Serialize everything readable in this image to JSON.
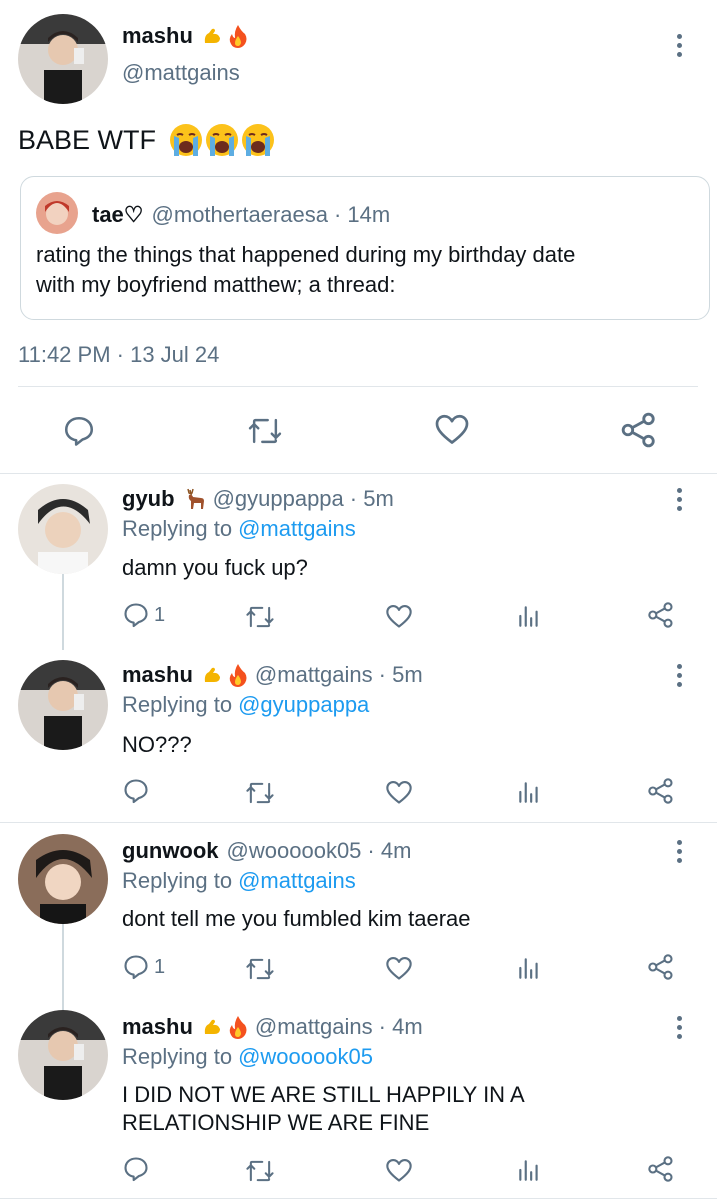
{
  "main_tweet": {
    "display_name": "mashu",
    "handle": "@mattgains",
    "text": "BABE WTF",
    "emojis": [
      "loudly-crying-face",
      "loudly-crying-face",
      "loudly-crying-face"
    ],
    "timestamp": "11:42 PM · 13 Jul 24",
    "quote": {
      "display_name": "tae♡",
      "handle": "@mothertaeraesa",
      "time": "· 14m",
      "line1": "rating the things that happened during my birthday date",
      "line2": "with my boyfriend matthew; a thread:"
    }
  },
  "replies": [
    {
      "display_name": "gyub",
      "name_emoji": "deer-icon",
      "handle": "@gyuppappa",
      "time": "· 5m",
      "replying_prefix": "Replying to",
      "replying_to": "@mattgains",
      "text": "damn you fuck up?",
      "reply_count": "1"
    },
    {
      "display_name": "mashu",
      "handle": "@mattgains",
      "time": "· 5m",
      "replying_prefix": "Replying to",
      "replying_to": "@gyuppappa",
      "text": "NO???",
      "reply_count": ""
    },
    {
      "display_name": "gunwook",
      "handle": "@woooook05",
      "time": "· 4m",
      "replying_prefix": "Replying to",
      "replying_to": "@mattgains",
      "text": "dont tell me you fumbled kim taerae",
      "reply_count": "1"
    },
    {
      "display_name": "mashu",
      "handle": "@mattgains",
      "time": "· 4m",
      "replying_prefix": "Replying to",
      "replying_to": "@woooook05",
      "text_line1": "I DID NOT WE ARE STILL HAPPILY IN A",
      "text_line2": "RELATIONSHIP WE ARE FINE",
      "reply_count": ""
    }
  ],
  "colors": {
    "text": "#0f1419",
    "secondary": "#5b7083",
    "link": "#1d9bf0",
    "divider": "#e1e6ea"
  }
}
